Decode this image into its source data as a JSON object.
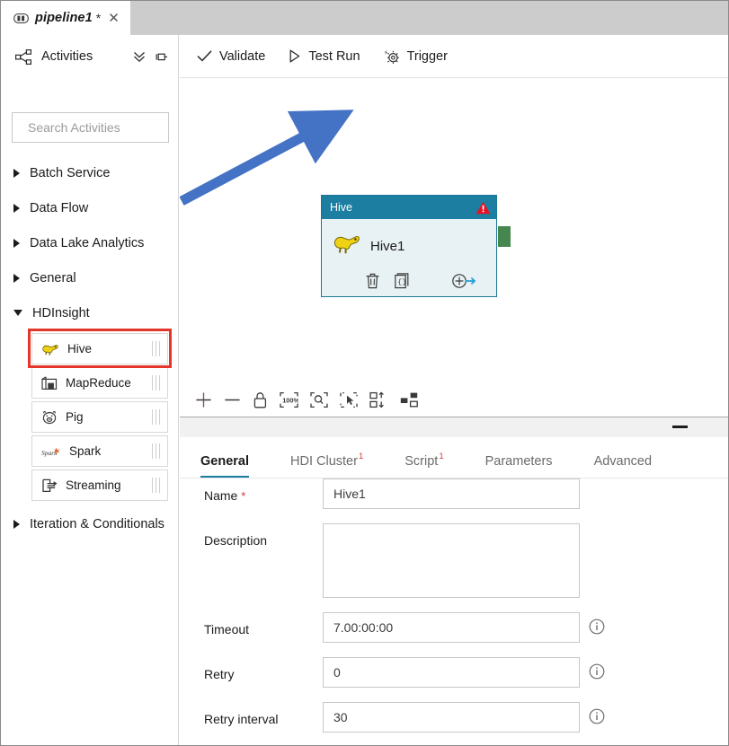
{
  "window": {
    "tab": {
      "title": "pipeline1",
      "dirty_marker": "*",
      "close_label": "✕",
      "icon": "pipeline-icon"
    }
  },
  "sidebar": {
    "header": {
      "title": "Activities",
      "icon": "activities-network-icon",
      "collapse_all_icon": "double-chevron-down-icon",
      "pin_icon": "pin-icon"
    },
    "search": {
      "placeholder": "Search Activities",
      "value": "",
      "icon": "search-icon"
    },
    "categories": [
      {
        "label": "Batch Service",
        "expanded": false
      },
      {
        "label": "Data Flow",
        "expanded": false
      },
      {
        "label": "Data Lake Analytics",
        "expanded": false
      },
      {
        "label": "General",
        "expanded": false
      },
      {
        "label": "HDInsight",
        "expanded": true
      },
      {
        "label": "Iteration & Conditionals",
        "expanded": false
      }
    ],
    "hdinsight_items": [
      {
        "label": "Hive",
        "icon": "hive-elephant-icon",
        "highlighted": true
      },
      {
        "label": "MapReduce",
        "icon": "mapreduce-icon",
        "highlighted": false
      },
      {
        "label": "Pig",
        "icon": "pig-icon",
        "highlighted": false
      },
      {
        "label": "Spark",
        "icon": "spark-icon",
        "highlighted": false
      },
      {
        "label": "Streaming",
        "icon": "streaming-icon",
        "highlighted": false
      }
    ],
    "highlight_color": "#e2372a"
  },
  "commandbar": {
    "items": [
      {
        "label": "Validate",
        "icon": "checkmark-icon"
      },
      {
        "label": "Test Run",
        "icon": "play-outline-icon"
      },
      {
        "label": "Trigger",
        "icon": "trigger-gear-icon"
      }
    ]
  },
  "canvas": {
    "node": {
      "header_title": "Hive",
      "header_color": "#1c7fa1",
      "body_color": "#e8f1f3",
      "name": "Hive1",
      "warning_icon": "warning-triangle-icon",
      "activity_icon": "hive-elephant-icon",
      "output_connector_color": "#45874f",
      "actions": [
        {
          "icon": "delete-trash-icon",
          "name": "delete"
        },
        {
          "icon": "code-braces-icon",
          "name": "view-code"
        },
        {
          "icon": "add-output-arrow-icon",
          "name": "add-output"
        }
      ]
    },
    "annotation_arrow_color": "#4472c4",
    "toolbar": [
      {
        "icon": "zoom-in-plus-icon",
        "name": "zoom-in"
      },
      {
        "icon": "zoom-out-minus-icon",
        "name": "zoom-out"
      },
      {
        "icon": "lock-icon",
        "name": "lock-canvas"
      },
      {
        "icon": "zoom-100-percent-icon",
        "name": "zoom-to-100"
      },
      {
        "icon": "zoom-to-fit-icon",
        "name": "zoom-to-fit"
      },
      {
        "icon": "select-marquee-icon",
        "name": "marquee-select"
      },
      {
        "icon": "auto-align-icon",
        "name": "auto-align"
      },
      {
        "icon": "auto-layout-icon",
        "name": "auto-layout"
      }
    ],
    "collapse_button": "minimize-dash-icon"
  },
  "properties": {
    "tabs": [
      {
        "label": "General",
        "badge": "",
        "active": true
      },
      {
        "label": "HDI Cluster",
        "badge": "1",
        "active": false
      },
      {
        "label": "Script",
        "badge": "1",
        "active": false
      },
      {
        "label": "Parameters",
        "badge": "",
        "active": false
      },
      {
        "label": "Advanced",
        "badge": "",
        "active": false
      }
    ],
    "fields": {
      "name": {
        "label": "Name",
        "required_marker": "*",
        "value": "Hive1",
        "placeholder": ""
      },
      "description": {
        "label": "Description",
        "value": "",
        "placeholder": ""
      },
      "timeout": {
        "label": "Timeout",
        "value": "7.00:00:00",
        "placeholder": "",
        "info_icon": "info-icon"
      },
      "retry": {
        "label": "Retry",
        "value": "0",
        "placeholder": "",
        "info_icon": "info-icon"
      },
      "retry_interval": {
        "label": "Retry interval",
        "value": "30",
        "placeholder": "",
        "info_icon": "info-icon"
      }
    }
  }
}
